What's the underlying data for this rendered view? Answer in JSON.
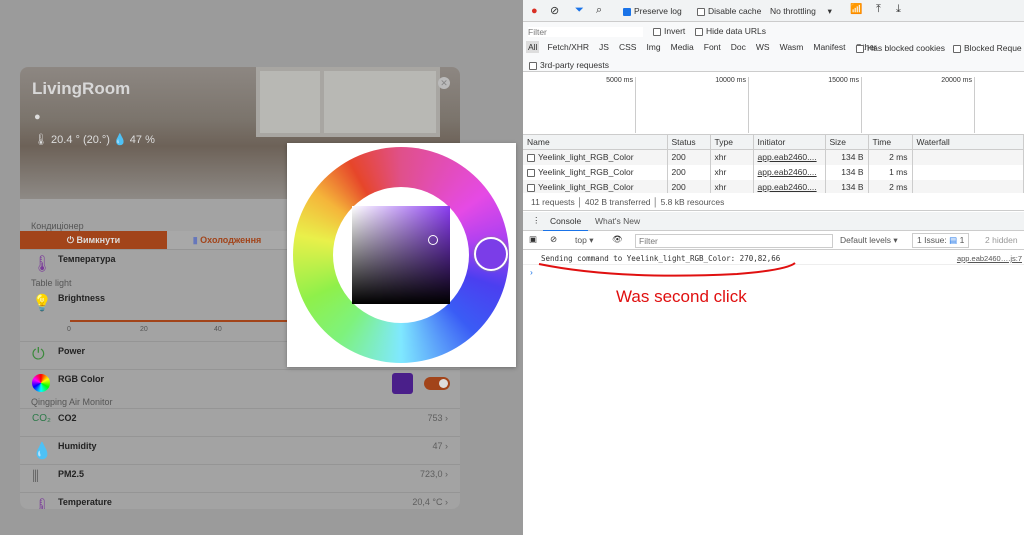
{
  "card": {
    "title": "LivingRoom",
    "temp": "20.4 ° (20.°)",
    "humidity": "47 %",
    "ac_section": "Кондиціонер",
    "ac_off": "Вимкнути",
    "ac_mode": "Охолодження",
    "temperature": "Температура",
    "light_section": "Table light",
    "brightness": "Brightness",
    "slider_ticks": [
      "0",
      "20",
      "40"
    ],
    "power": "Power",
    "rgb": "RGB Color",
    "rgb_color": "#4a1f8a",
    "toggle_on": true,
    "air_section": "Qingping Air Monitor",
    "sensors": [
      {
        "label": "CO2",
        "value": "753"
      },
      {
        "label": "Humidity",
        "value": "47"
      },
      {
        "label": "PM2.5",
        "value": "723,0"
      },
      {
        "label": "Temperature",
        "value": "20,4 °C"
      }
    ],
    "co2_icon": "CO₂"
  },
  "picker": {
    "selected_color": "#7b3de8"
  },
  "devtools": {
    "toolbar": {
      "preserve_log": "Preserve log",
      "disable_cache": "Disable cache",
      "throttling": "No throttling"
    },
    "filter_placeholder": "Filter",
    "invert": "Invert",
    "hide_data_urls": "Hide data URLs",
    "types": [
      "All",
      "Fetch/XHR",
      "JS",
      "CSS",
      "Img",
      "Media",
      "Font",
      "Doc",
      "WS",
      "Wasm",
      "Manifest",
      "Other"
    ],
    "has_blocked_cookies": "Has blocked cookies",
    "blocked_requests": "Blocked Reque",
    "third_party": "3rd-party requests",
    "timeline": [
      "5000 ms",
      "10000 ms",
      "15000 ms",
      "20000 ms"
    ],
    "columns": [
      "Name",
      "Status",
      "Type",
      "Initiator",
      "Size",
      "Time",
      "Waterfall"
    ],
    "rows": [
      {
        "name": "Yeelink_light_RGB_Color",
        "status": "200",
        "type": "xhr",
        "initiator": "app.eab2460....",
        "size": "134 B",
        "time": "2 ms"
      },
      {
        "name": "Yeelink_light_RGB_Color",
        "status": "200",
        "type": "xhr",
        "initiator": "app.eab2460....",
        "size": "134 B",
        "time": "1 ms"
      },
      {
        "name": "Yeelink_light_RGB_Color",
        "status": "200",
        "type": "xhr",
        "initiator": "app.eab2460....",
        "size": "134 B",
        "time": "2 ms"
      }
    ],
    "summary": [
      "11 requests",
      "402 B transferred",
      "5.8 kB resources"
    ],
    "drawer_tabs": [
      "Console",
      "What's New"
    ],
    "console": {
      "context": "top",
      "filter_placeholder": "Filter",
      "levels": "Default levels",
      "issues": "1 Issue:",
      "issue_count": "1",
      "hidden": "2 hidden",
      "message": "Sending command to Yeelink_light_RGB_Color: 270,82,66",
      "source": "app.eab2460….js:7"
    }
  },
  "annotation": "Was second click"
}
